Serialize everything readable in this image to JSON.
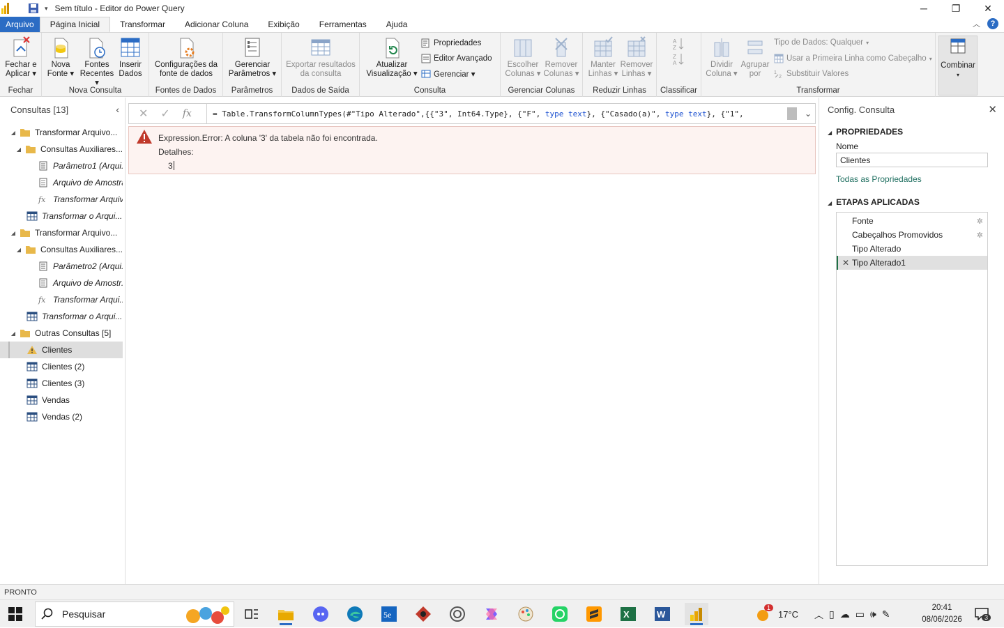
{
  "window": {
    "title": "Sem título - Editor do Power Query"
  },
  "tabs": [
    {
      "label": "Arquivo"
    },
    {
      "label": "Página Inicial"
    },
    {
      "label": "Transformar"
    },
    {
      "label": "Adicionar Coluna"
    },
    {
      "label": "Exibição"
    },
    {
      "label": "Ferramentas"
    },
    {
      "label": "Ajuda"
    }
  ],
  "ribbon": {
    "groups": {
      "fechar": "Fechar",
      "nova_consulta": "Nova Consulta",
      "fontes_dados": "Fontes de Dados",
      "parametros": "Parâmetros",
      "dados_saida": "Dados de Saída",
      "consulta": "Consulta",
      "gerenciar_colunas": "Gerenciar Colunas",
      "reduzir_linhas": "Reduzir Linhas",
      "classificar": "Classificar",
      "transformar": "Transformar"
    },
    "fechar_aplicar": [
      "Fechar e",
      "Aplicar"
    ],
    "nova_fonte": [
      "Nova",
      "Fonte"
    ],
    "fontes_recentes": [
      "Fontes",
      "Recentes"
    ],
    "inserir_dados": [
      "Inserir",
      "Dados"
    ],
    "config_fonte": [
      "Configurações da",
      "fonte de dados"
    ],
    "gerenciar_parametros": [
      "Gerenciar",
      "Parâmetros"
    ],
    "exportar": [
      "Exportar resultados",
      "da consulta"
    ],
    "atualizar": [
      "Atualizar",
      "Visualização"
    ],
    "propriedades": "Propriedades",
    "editor_avancado": "Editor Avançado",
    "gerenciar": "Gerenciar",
    "escolher_colunas": [
      "Escolher",
      "Colunas"
    ],
    "remover_colunas": [
      "Remover",
      "Colunas"
    ],
    "manter_linhas": [
      "Manter",
      "Linhas"
    ],
    "remover_linhas": [
      "Remover",
      "Linhas"
    ],
    "dividir_coluna": [
      "Dividir",
      "Coluna"
    ],
    "agrupar_por": [
      "Agrupar",
      "por"
    ],
    "tipo_dados": "Tipo de Dados: Qualquer",
    "primeira_linha": "Usar a Primeira Linha como Cabeçalho",
    "substituir_valores": "Substituir Valores",
    "combinar": "Combinar"
  },
  "queries_panel": {
    "header": "Consultas [13]",
    "items": [
      {
        "label": "Transformar Arquivo...",
        "level": 0,
        "kind": "folder"
      },
      {
        "label": "Consultas Auxiliares...",
        "level": 1,
        "kind": "folder"
      },
      {
        "label": "Parâmetro1 (Arqui...",
        "level": 2,
        "kind": "param"
      },
      {
        "label": "Arquivo de Amostra",
        "level": 2,
        "kind": "list"
      },
      {
        "label": "Transformar Arquivo",
        "level": 2,
        "kind": "fx"
      },
      {
        "label": "Transformar o Arqui...",
        "level": 1,
        "kind": "table"
      },
      {
        "label": "Transformar Arquivo...",
        "level": 0,
        "kind": "folder"
      },
      {
        "label": "Consultas Auxiliares...",
        "level": 1,
        "kind": "folder"
      },
      {
        "label": "Parâmetro2 (Arqui...",
        "level": 2,
        "kind": "param"
      },
      {
        "label": "Arquivo de Amostr...",
        "level": 2,
        "kind": "list"
      },
      {
        "label": "Transformar Arqui...",
        "level": 2,
        "kind": "fx"
      },
      {
        "label": "Transformar o Arqui...",
        "level": 1,
        "kind": "table"
      },
      {
        "label": "Outras Consultas [5]",
        "level": 0,
        "kind": "folder"
      },
      {
        "label": "Clientes",
        "level": 1,
        "kind": "warning"
      },
      {
        "label": "Clientes (2)",
        "level": 1,
        "kind": "table"
      },
      {
        "label": "Clientes (3)",
        "level": 1,
        "kind": "table"
      },
      {
        "label": "Vendas",
        "level": 1,
        "kind": "table"
      },
      {
        "label": "Vendas (2)",
        "level": 1,
        "kind": "table"
      }
    ]
  },
  "formula": {
    "prefix": "= Table.TransformColumnTypes(#\"Tipo Alterado\",{{\"3\", Int64.Type}, {\"F\", ",
    "kw1": "type",
    "mid1": " ",
    "kw2": "text",
    "mid2": "}, {\"Casado(a)\", ",
    "kw3": "type",
    "mid3": " ",
    "kw4": "text",
    "suffix": "}, {\"1\","
  },
  "error": {
    "message": "Expression.Error: A coluna '3' da tabela não foi encontrada.",
    "details_label": "Detalhes:",
    "value": "3"
  },
  "settings_panel": {
    "header": "Config. Consulta",
    "properties_title": "PROPRIEDADES",
    "name_label": "Nome",
    "name_value": "Clientes",
    "all_props_link": "Todas as Propriedades",
    "steps_title": "ETAPAS APLICADAS",
    "steps": [
      {
        "label": "Fonte",
        "gear": true
      },
      {
        "label": "Cabeçalhos Promovidos",
        "gear": true
      },
      {
        "label": "Tipo Alterado",
        "gear": false
      },
      {
        "label": "Tipo Alterado1",
        "gear": false
      }
    ]
  },
  "status": "PRONTO",
  "taskbar": {
    "search_placeholder": "Pesquisar",
    "temperature": "17°C",
    "weather_badge": "1",
    "time": "20:41",
    "date": "08/06/2026",
    "notifications": "3"
  },
  "colors": {
    "accent_blue": "#2b6cc4",
    "error_bg": "#fdf3f1",
    "warning_red": "#c0392b",
    "link_green": "#1f6f60",
    "folder_yellow": "#e8b84a"
  }
}
